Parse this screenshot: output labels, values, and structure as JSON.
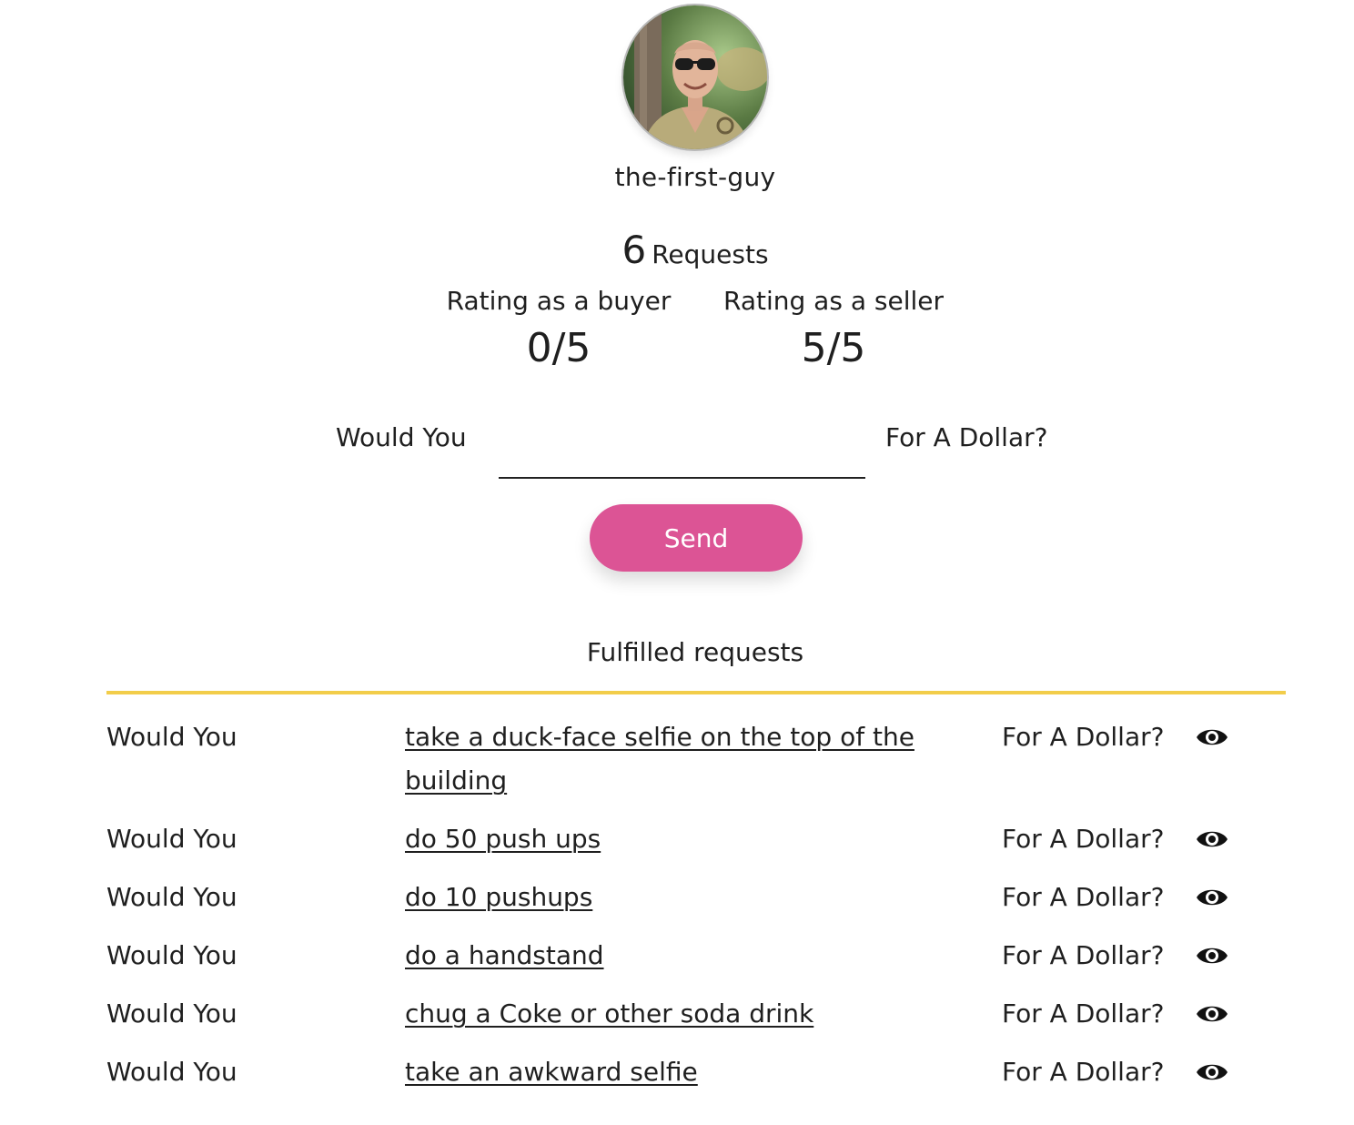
{
  "profile": {
    "username": "the-first-guy",
    "avatar": "avatar-photo"
  },
  "stats": {
    "requests_count": "6",
    "requests_label": "Requests",
    "buyer_rating_label": "Rating as a buyer",
    "buyer_rating_value": "0/5",
    "seller_rating_label": "Rating as a seller",
    "seller_rating_value": "5/5"
  },
  "request_form": {
    "prefix": "Would You",
    "input_value": "",
    "input_placeholder": "",
    "suffix": "For A Dollar?",
    "send_label": "Send"
  },
  "fulfilled": {
    "title": "Fulfilled requests",
    "divider_color": "#f2cd4a",
    "items": [
      {
        "prefix": "Would You",
        "task": "take a duck-face selfie on the top of the building",
        "suffix": "For A Dollar?",
        "icon": "eye-icon"
      },
      {
        "prefix": "Would You",
        "task": "do 50 push ups",
        "suffix": "For A Dollar?",
        "icon": "eye-icon"
      },
      {
        "prefix": "Would You",
        "task": "do 10 pushups",
        "suffix": "For A Dollar?",
        "icon": "eye-icon"
      },
      {
        "prefix": "Would You",
        "task": "do a handstand",
        "suffix": "For A Dollar?",
        "icon": "eye-icon"
      },
      {
        "prefix": "Would You",
        "task": "chug a Coke or other soda drink",
        "suffix": "For A Dollar?",
        "icon": "eye-icon"
      },
      {
        "prefix": "Would You",
        "task": "take an awkward selfie",
        "suffix": "For A Dollar?",
        "icon": "eye-icon"
      }
    ]
  },
  "colors": {
    "send_button": "#dc5495",
    "divider": "#f2cd4a",
    "text": "#1f1f1f"
  }
}
